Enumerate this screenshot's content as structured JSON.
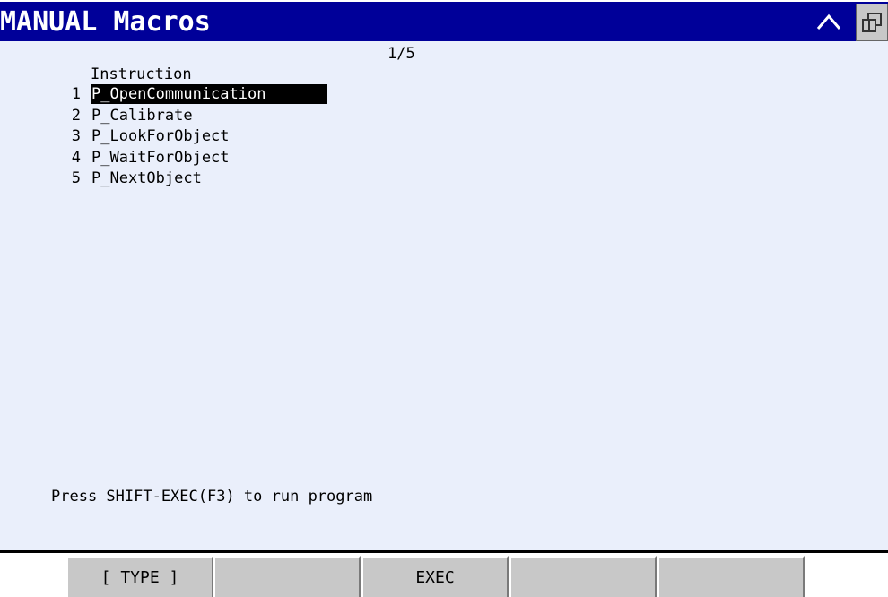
{
  "title": "MANUAL Macros",
  "page_indicator": "1/5",
  "list": {
    "header": "Instruction",
    "items": [
      {
        "num": "1",
        "label": "P_OpenCommunication",
        "selected": true
      },
      {
        "num": "2",
        "label": "P_Calibrate",
        "selected": false
      },
      {
        "num": "3",
        "label": "P_LookForObject",
        "selected": false
      },
      {
        "num": "4",
        "label": "P_WaitForObject",
        "selected": false
      },
      {
        "num": "5",
        "label": "P_NextObject",
        "selected": false
      }
    ]
  },
  "status_message": "Press SHIFT-EXEC(F3) to run program",
  "function_keys": [
    {
      "label": "[ TYPE ]"
    },
    {
      "label": ""
    },
    {
      "label": "EXEC"
    },
    {
      "label": ""
    },
    {
      "label": ""
    }
  ],
  "icons": {
    "up": "caret-up-icon",
    "window": "window-toggle-icon"
  },
  "colors": {
    "titlebar": "#000099",
    "background": "#eaeffb",
    "selection": "#000000",
    "function_key": "#c8c8c8"
  }
}
